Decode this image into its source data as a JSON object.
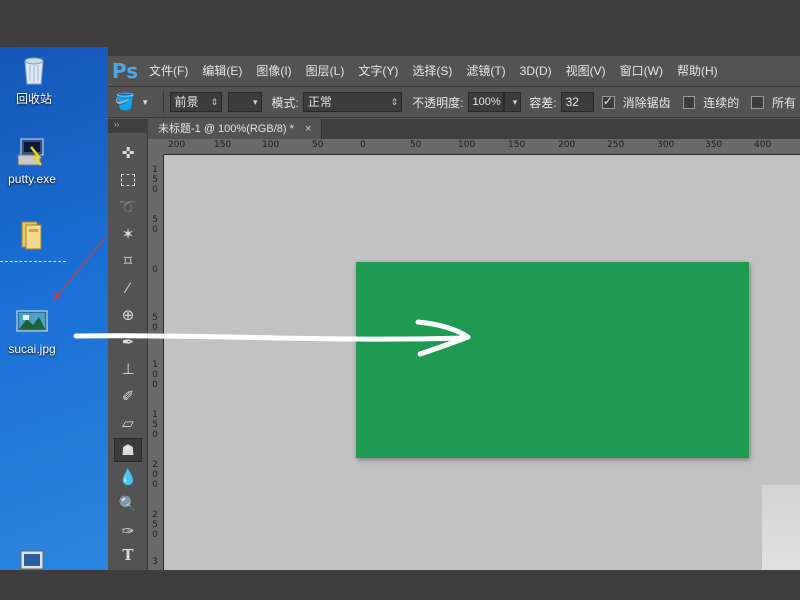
{
  "desktop": {
    "icons": [
      {
        "label": "回收站",
        "icon": "recycle-bin-icon"
      },
      {
        "label": "putty.exe",
        "icon": "putty-icon"
      },
      {
        "label": "",
        "icon": "folder-icon"
      },
      {
        "label": "sucai.jpg",
        "icon": "image-file-icon"
      },
      {
        "label": "",
        "icon": "computer-icon"
      }
    ]
  },
  "app": {
    "logo": "Ps",
    "menu": [
      "文件(F)",
      "编辑(E)",
      "图像(I)",
      "图层(L)",
      "文字(Y)",
      "选择(S)",
      "滤镜(T)",
      "3D(D)",
      "视图(V)",
      "窗口(W)",
      "帮助(H)"
    ]
  },
  "options": {
    "tool_icon": "paint-bucket-icon",
    "fill_source": "前景",
    "mode_label": "模式:",
    "mode_value": "正常",
    "opacity_label": "不透明度:",
    "opacity_value": "100%",
    "tolerance_label": "容差:",
    "tolerance_value": "32",
    "antialias_label": "消除锯齿",
    "antialias_checked": true,
    "contiguous_label": "连续的",
    "contiguous_checked": false,
    "all_layers_label": "所有"
  },
  "document": {
    "tab_title": "未标题-1 @ 100%(RGB/8) *",
    "close_glyph": "×",
    "fill_color": "#1e9a52",
    "canvas_color": "#c2c2c2"
  },
  "rulers": {
    "horizontal": [
      "200",
      "150",
      "100",
      "50",
      "0",
      "50",
      "100",
      "150",
      "200",
      "250",
      "300",
      "350",
      "400"
    ],
    "vertical": [
      "150",
      "50",
      "0",
      "50",
      "100",
      "150",
      "200",
      "250",
      "3"
    ]
  },
  "tools": [
    "move-icon",
    "marquee-icon",
    "lasso-icon",
    "magic-wand-icon",
    "crop-icon",
    "eyedropper-icon",
    "healing-brush-icon",
    "brush-icon",
    "clone-stamp-icon",
    "history-brush-icon",
    "eraser-icon",
    "paint-bucket-icon",
    "blur-icon",
    "dodge-icon",
    "pen-icon",
    "type-icon"
  ],
  "toolbox_collapse": "››"
}
